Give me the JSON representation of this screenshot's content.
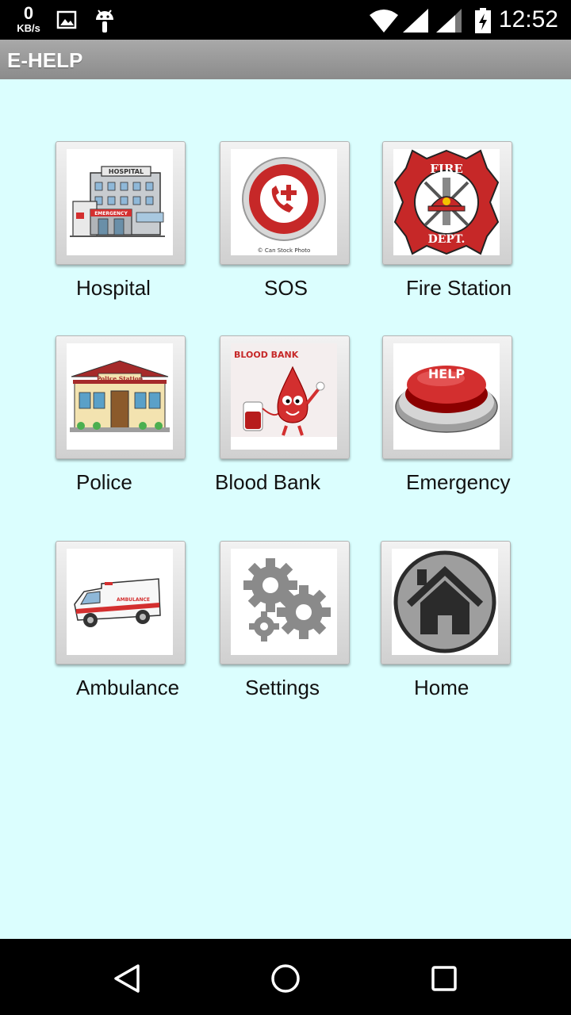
{
  "status": {
    "speed_value": "0",
    "speed_unit": "KB/s",
    "time": "12:52",
    "icons": [
      "image-icon",
      "android-icon",
      "wifi-icon",
      "signal-icon",
      "signal-icon-2",
      "battery-charging-icon"
    ]
  },
  "app": {
    "title": "E-HELP"
  },
  "tiles": [
    {
      "label": "Hospital",
      "icon": "hospital-icon"
    },
    {
      "label": "SOS",
      "icon": "sos-phone-icon",
      "caption": "© Can Stock Photo"
    },
    {
      "label": "Fire Station",
      "icon": "fire-dept-icon",
      "badge_top": "FIRE",
      "badge_bottom": "DEPT."
    },
    {
      "label": "Police",
      "icon": "police-station-icon",
      "sign": "Police Station"
    },
    {
      "label": "Blood Bank",
      "icon": "blood-bank-icon",
      "banner": "BLOOD BANK"
    },
    {
      "label": "Emergency",
      "icon": "help-button-icon",
      "button_text": "HELP"
    },
    {
      "label": "Ambulance",
      "icon": "ambulance-icon",
      "vehicle_text": "AMBULANCE"
    },
    {
      "label": "Settings",
      "icon": "gears-icon"
    },
    {
      "label": "Home",
      "icon": "home-icon"
    }
  ],
  "hospital_signs": {
    "top": "HOSPITAL",
    "door": "EMERGENCY"
  },
  "nav": [
    "back-icon",
    "home-circle-icon",
    "recents-icon"
  ]
}
